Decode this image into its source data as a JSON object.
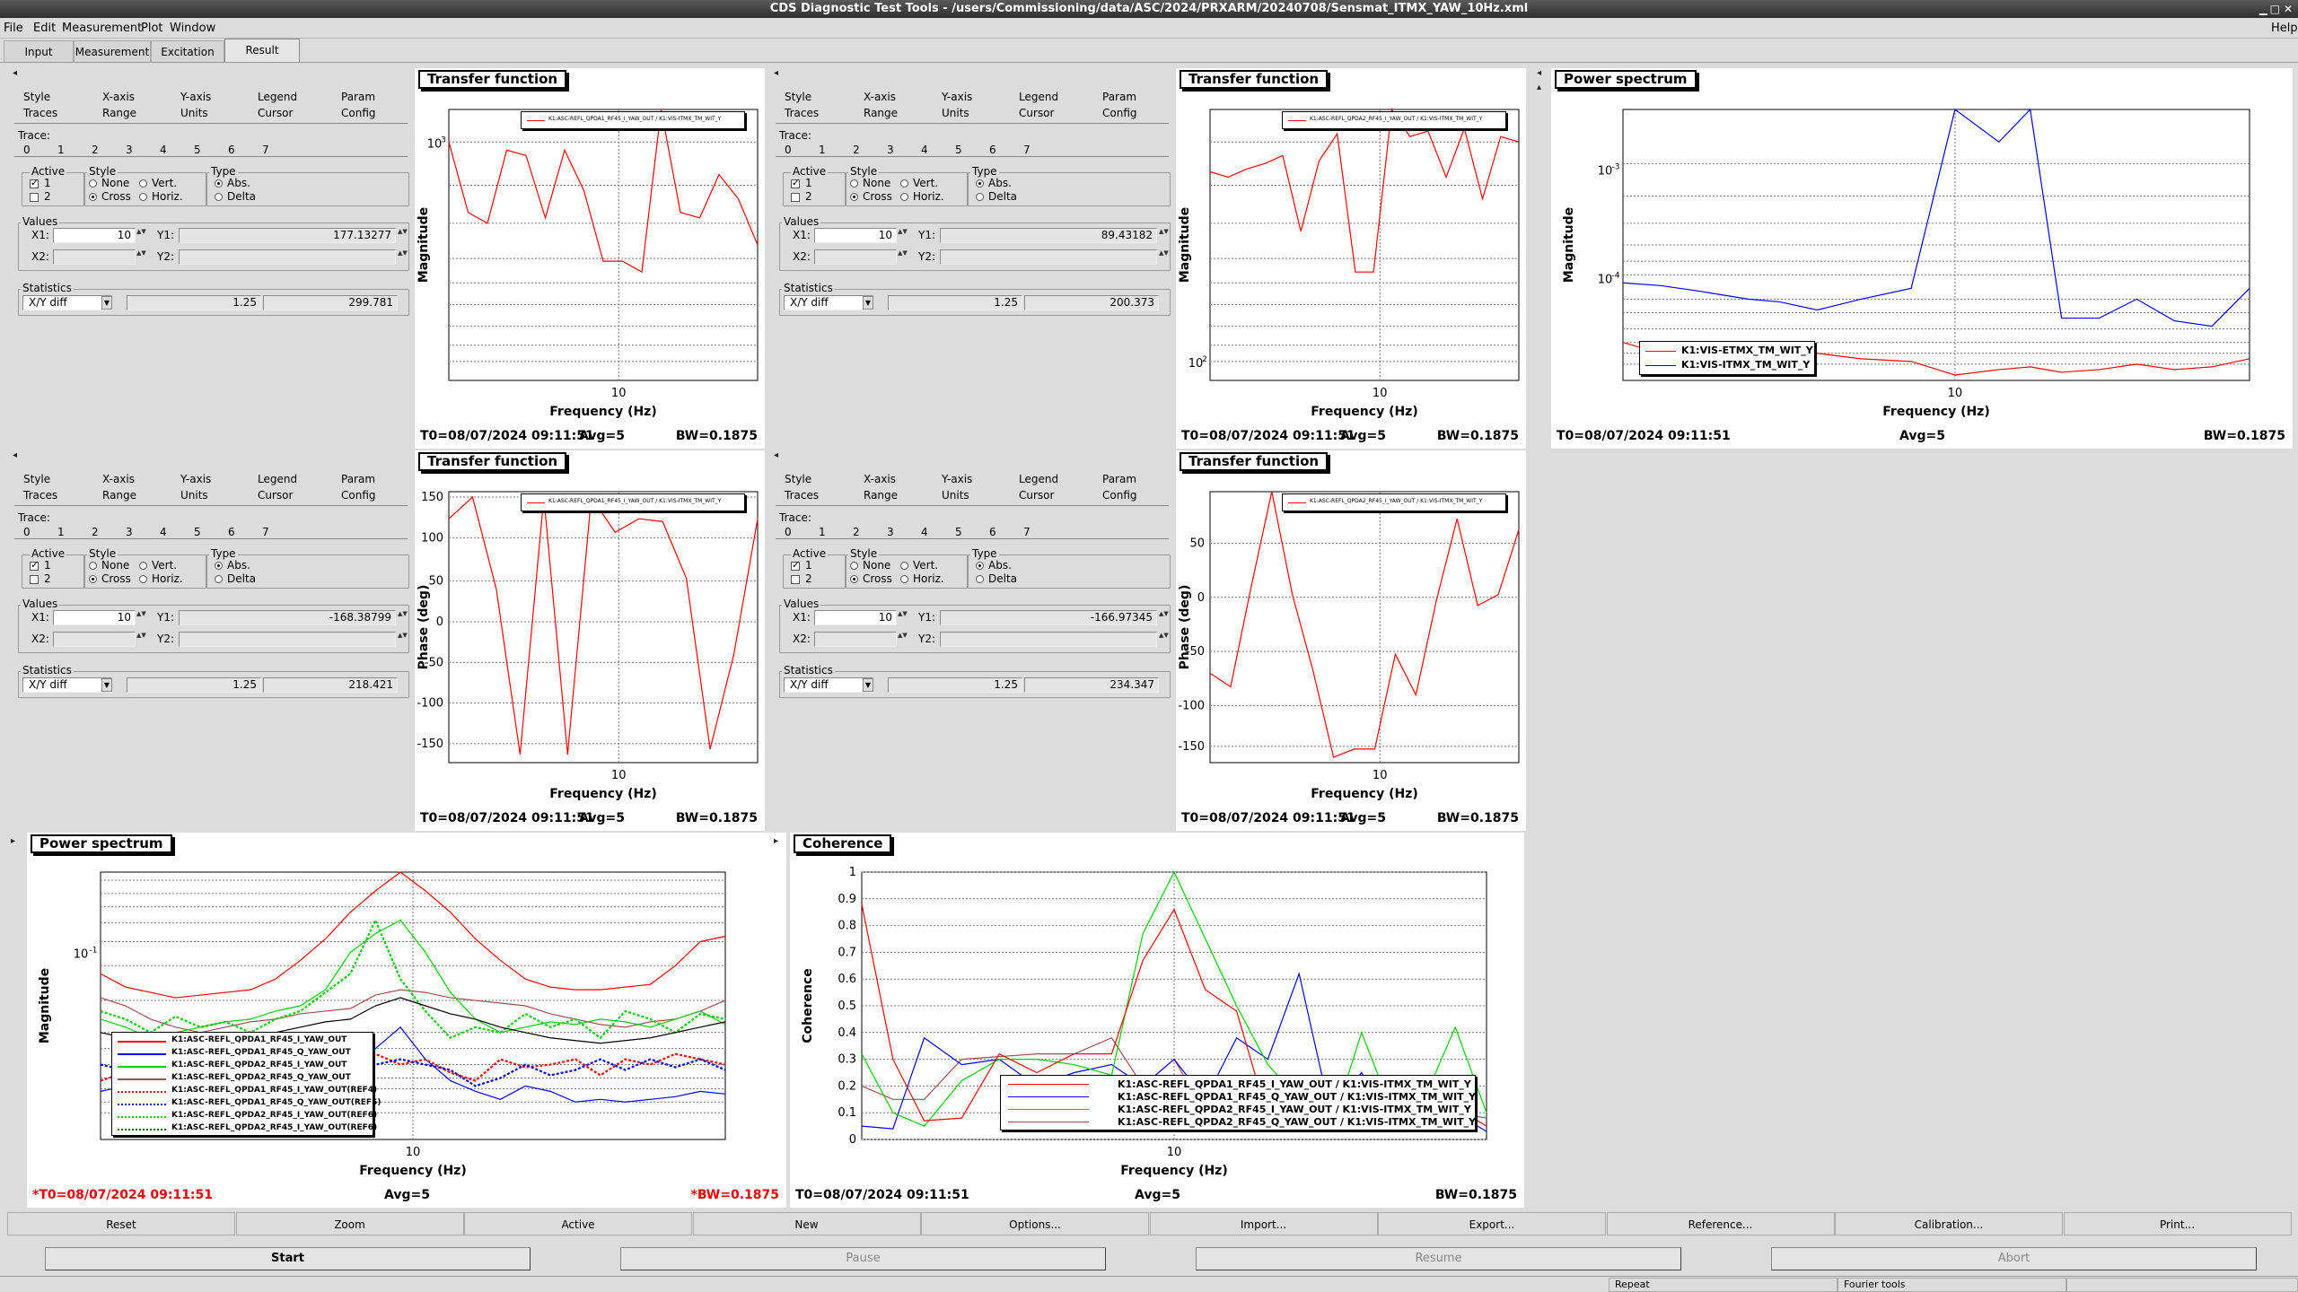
{
  "window": {
    "title": "CDS Diagnostic Test Tools - /users/Commissioning/data/ASC/2024/PRXARM/20240708/Sensmat_ITMX_YAW_10Hz.xml"
  },
  "menu": [
    "File",
    "Edit",
    "Measurement",
    "Plot",
    "Window",
    "Help"
  ],
  "tabs": [
    "Input",
    "Measurement",
    "Excitation",
    "Result"
  ],
  "opt_tabs": {
    "row1": [
      "Style",
      "X-axis",
      "Y-axis",
      "Legend",
      "Param"
    ],
    "row2": [
      "Traces",
      "Range",
      "Units",
      "Cursor",
      "Config"
    ]
  },
  "trace_label": "Trace:",
  "trace_nums": [
    "0",
    "1",
    "2",
    "3",
    "4",
    "5",
    "6",
    "7"
  ],
  "active_label": "Active",
  "style_label": "Style",
  "type_label": "Type",
  "style_opts": [
    "None",
    "Vert.",
    "Cross",
    "Horiz."
  ],
  "type_opts": [
    "Abs.",
    "Delta"
  ],
  "values_label": "Values",
  "x1": "X1:",
  "y1": "Y1:",
  "x2": "X2:",
  "y2": "Y2:",
  "statistics_label": "Statistics",
  "stat_mode": "X/Y diff",
  "panes": [
    {
      "x1": "10",
      "y1": "177.13277",
      "s1": "1.25",
      "s2": "299.781"
    },
    {
      "x1": "10",
      "y1": "89.43182",
      "s1": "1.25",
      "s2": "200.373"
    },
    {
      "x1": "10",
      "y1": "-168.38799",
      "s1": "1.25",
      "s2": "218.421"
    },
    {
      "x1": "10",
      "y1": "-166.97345",
      "s1": "1.25",
      "s2": "234.347"
    }
  ],
  "plots": {
    "tf1": {
      "title": "Transfer function",
      "ylabel": "Magnitude",
      "xlabel": "Frequency (Hz)",
      "xtick": "10",
      "ytick_major": "10",
      "ytick_exp": "3",
      "legend": "K1:ASC-REFL_QPDA1_RF45_I_YAW_OUT / K1:VIS-ITMX_TM_WIT_Y",
      "t0": "T0=08/07/2024 09:11:51",
      "avg": "Avg=5",
      "bw": "BW=0.1875"
    },
    "tf2": {
      "title": "Transfer function",
      "ylabel": "Magnitude",
      "xlabel": "Frequency (Hz)",
      "xtick": "10",
      "ytick_major": "10",
      "ytick_exp": "2",
      "legend": "K1:ASC-REFL_QPDA2_RF45_I_YAW_OUT / K1:VIS-ITMX_TM_WIT_Y",
      "t0": "T0=08/07/2024 09:11:51",
      "avg": "Avg=5",
      "bw": "BW=0.1875"
    },
    "ps1": {
      "title": "Power spectrum",
      "ylabel": "Magnitude",
      "xlabel": "Frequency (Hz)",
      "xtick": "10",
      "ytick_major": "10",
      "yticks_exp": [
        "-3",
        "-4"
      ],
      "legend": [
        "K1:VIS-ETMX_TM_WIT_Y",
        "K1:VIS-ITMX_TM_WIT_Y"
      ],
      "t0": "T0=08/07/2024 09:11:51",
      "avg": "Avg=5",
      "bw": "BW=0.1875"
    },
    "ph1": {
      "title": "Transfer function",
      "ylabel": "Phase (deg)",
      "xlabel": "Frequency (Hz)",
      "xtick": "10",
      "yticks": [
        "150",
        "100",
        "50",
        "0",
        "-50",
        "-100",
        "-150"
      ],
      "legend": "K1:ASC-REFL_QPDA1_RF45_I_YAW_OUT / K1:VIS-ITMX_TM_WIT_Y",
      "t0": "T0=08/07/2024 09:11:51",
      "avg": "Avg=5",
      "bw": "BW=0.1875"
    },
    "ph2": {
      "title": "Transfer function",
      "ylabel": "Phase (deg)",
      "xlabel": "Frequency (Hz)",
      "xtick": "10",
      "yticks": [
        "50",
        "0",
        "-50",
        "-100",
        "-150"
      ],
      "legend": "K1:ASC-REFL_QPDA2_RF45_I_YAW_OUT / K1:VIS-ITMX_TM_WIT_Y",
      "t0": "T0=08/07/2024 09:11:51",
      "avg": "Avg=5",
      "bw": "BW=0.1875"
    },
    "ps2": {
      "title": "Power spectrum",
      "ylabel": "Magnitude",
      "xlabel": "Frequency (Hz)",
      "xtick": "10",
      "ytick_major": "10",
      "ytick_exp": "-1",
      "legend": [
        "K1:ASC-REFL_QPDA1_RF45_I_YAW_OUT",
        "K1:ASC-REFL_QPDA1_RF45_Q_YAW_OUT",
        "K1:ASC-REFL_QPDA2_RF45_I_YAW_OUT",
        "K1:ASC-REFL_QPDA2_RF45_Q_YAW_OUT",
        "K1:ASC-REFL_QPDA1_RF45_I_YAW_OUT(REF4)",
        "K1:ASC-REFL_QPDA1_RF45_Q_YAW_OUT(REF5)",
        "K1:ASC-REFL_QPDA2_RF45_I_YAW_OUT(REF6)",
        "K1:ASC-REFL_QPDA2_RF45_I_YAW_OUT(REF6)"
      ],
      "t0": "*T0=08/07/2024 09:11:51",
      "avg": "Avg=5",
      "bw": "*BW=0.1875"
    },
    "coh": {
      "title": "Coherence",
      "ylabel": "Coherence",
      "xlabel": "Frequency (Hz)",
      "xtick": "10",
      "yticks": [
        "1",
        "0.9",
        "0.8",
        "0.7",
        "0.6",
        "0.5",
        "0.4",
        "0.3",
        "0.2",
        "0.1",
        "0"
      ],
      "legend": [
        "K1:ASC-REFL_QPDA1_RF45_I_YAW_OUT / K1:VIS-ITMX_TM_WIT_Y",
        "K1:ASC-REFL_QPDA1_RF45_Q_YAW_OUT / K1:VIS-ITMX_TM_WIT_Y",
        "K1:ASC-REFL_QPDA2_RF45_I_YAW_OUT / K1:VIS-ITMX_TM_WIT_Y",
        "K1:ASC-REFL_QPDA2_RF45_Q_YAW_OUT / K1:VIS-ITMX_TM_WIT_Y"
      ],
      "t0": "T0=08/07/2024 09:11:51",
      "avg": "Avg=5",
      "bw": "BW=0.1875"
    }
  },
  "bottom_buttons": [
    "Reset",
    "Zoom",
    "Active",
    "New",
    "Options...",
    "Import...",
    "Export...",
    "Reference...",
    "Calibration...",
    "Print..."
  ],
  "control_buttons": [
    "Start",
    "Pause",
    "Resume",
    "Abort"
  ],
  "status": [
    "Repeat",
    "Fourier tools"
  ],
  "colors": {
    "red": "#ff0000",
    "blue": "#0000ff",
    "green": "#00cc00",
    "brown": "#a05050"
  }
}
